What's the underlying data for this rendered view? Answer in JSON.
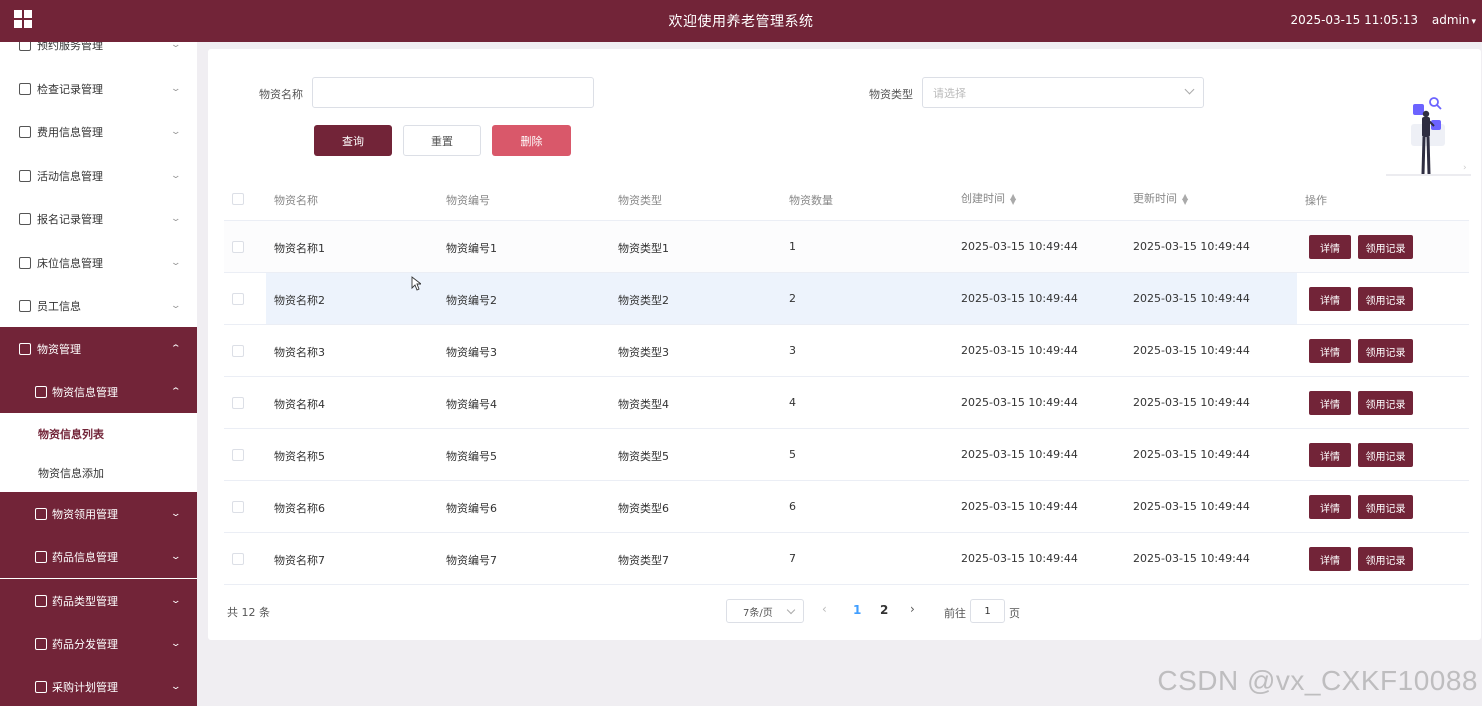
{
  "header": {
    "title": "欢迎使用养老管理系统",
    "datetime": "2025-03-15 11:05:13",
    "user": "admin"
  },
  "sidebar": {
    "items": [
      {
        "label": "预约服务管理",
        "state": "collapsed"
      },
      {
        "label": "检查记录管理",
        "state": "collapsed"
      },
      {
        "label": "费用信息管理",
        "state": "collapsed"
      },
      {
        "label": "活动信息管理",
        "state": "collapsed"
      },
      {
        "label": "报名记录管理",
        "state": "collapsed"
      },
      {
        "label": "床位信息管理",
        "state": "collapsed"
      },
      {
        "label": "员工信息",
        "state": "collapsed"
      },
      {
        "label": "物资管理",
        "state": "expanded"
      },
      {
        "label": "物资信息管理",
        "state": "expanded"
      },
      {
        "label": "物资信息列表",
        "state": "active"
      },
      {
        "label": "物资信息添加",
        "state": "leaf"
      },
      {
        "label": "物资领用管理",
        "state": "collapsed"
      },
      {
        "label": "药品信息管理",
        "state": "collapsed"
      },
      {
        "label": "药品类型管理",
        "state": "collapsed"
      },
      {
        "label": "药品分发管理",
        "state": "collapsed"
      },
      {
        "label": "采购计划管理",
        "state": "collapsed"
      }
    ]
  },
  "search": {
    "name_label": "物资名称",
    "name_value": "",
    "type_label": "物资类型",
    "type_placeholder": "请选择",
    "query_button": "查询",
    "reset_button": "重置",
    "delete_button": "删除"
  },
  "table": {
    "columns": [
      "物资名称",
      "物资编号",
      "物资类型",
      "物资数量",
      "创建时间",
      "更新时间",
      "操作"
    ],
    "rows": [
      {
        "name": "物资名称1",
        "code": "物资编号1",
        "type": "物资类型1",
        "qty": "1",
        "created": "2025-03-15 10:49:44",
        "updated": "2025-03-15 10:49:44"
      },
      {
        "name": "物资名称2",
        "code": "物资编号2",
        "type": "物资类型2",
        "qty": "2",
        "created": "2025-03-15 10:49:44",
        "updated": "2025-03-15 10:49:44"
      },
      {
        "name": "物资名称3",
        "code": "物资编号3",
        "type": "物资类型3",
        "qty": "3",
        "created": "2025-03-15 10:49:44",
        "updated": "2025-03-15 10:49:44"
      },
      {
        "name": "物资名称4",
        "code": "物资编号4",
        "type": "物资类型4",
        "qty": "4",
        "created": "2025-03-15 10:49:44",
        "updated": "2025-03-15 10:49:44"
      },
      {
        "name": "物资名称5",
        "code": "物资编号5",
        "type": "物资类型5",
        "qty": "5",
        "created": "2025-03-15 10:49:44",
        "updated": "2025-03-15 10:49:44"
      },
      {
        "name": "物资名称6",
        "code": "物资编号6",
        "type": "物资类型6",
        "qty": "6",
        "created": "2025-03-15 10:49:44",
        "updated": "2025-03-15 10:49:44"
      },
      {
        "name": "物资名称7",
        "code": "物资编号7",
        "type": "物资类型7",
        "qty": "7",
        "created": "2025-03-15 10:49:44",
        "updated": "2025-03-15 10:49:44"
      }
    ],
    "detail_button": "详情",
    "record_button": "领用记录"
  },
  "pager": {
    "total": "共 12 条",
    "page_size": "7条/页",
    "pages": [
      "1",
      "2"
    ],
    "current_page": "1",
    "goto_label": "前往",
    "goto_value": "1",
    "page_suffix": "页"
  },
  "watermark": "CSDN @vx_CXKF10088",
  "colors": {
    "brand": "#722438",
    "danger": "#d9586a",
    "active_page": "#409eff"
  }
}
